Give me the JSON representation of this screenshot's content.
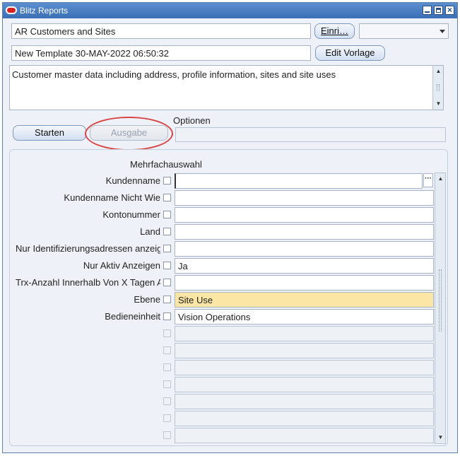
{
  "window": {
    "title": "Blitz Reports"
  },
  "template": {
    "report_name": "AR Customers and Sites",
    "report_button": "Einri…",
    "template_name": "New Template 30-MAY-2022 06:50:32",
    "edit_button": "Edit Vorlage",
    "combo_value": ""
  },
  "description": "Customer master data including address, profile information, sites and site uses",
  "actions": {
    "start_label": "Starten",
    "output_label": "Ausgabe",
    "options_label": "Optionen",
    "options_value": ""
  },
  "parameters": {
    "header": "Mehrfachauswahl",
    "rows": [
      {
        "label": "Kundenname",
        "value": ""
      },
      {
        "label": "Kundenname Nicht Wie",
        "value": ""
      },
      {
        "label": "Kontonummer",
        "value": ""
      },
      {
        "label": "Land",
        "value": ""
      },
      {
        "label": "Nur Identifizierungsadressen anzeigen",
        "value": ""
      },
      {
        "label": "Nur Aktiv Anzeigen",
        "value": "Ja"
      },
      {
        "label": "Trx-Anzahl Innerhalb Von X Tagen Anzeigen",
        "value": ""
      },
      {
        "label": "Ebene",
        "value": "Site Use"
      },
      {
        "label": "Bedieneinheit",
        "value": "Vision Operations"
      },
      {
        "label": "",
        "value": ""
      },
      {
        "label": "",
        "value": ""
      },
      {
        "label": "",
        "value": ""
      },
      {
        "label": "",
        "value": ""
      },
      {
        "label": "",
        "value": ""
      },
      {
        "label": "",
        "value": ""
      },
      {
        "label": "",
        "value": ""
      }
    ]
  },
  "colors": {
    "titlebar": "#3a6fb5",
    "highlight": "#fbe6a6",
    "annotation": "#d84444"
  },
  "icons": {
    "lov": "ellipsis-icon"
  }
}
